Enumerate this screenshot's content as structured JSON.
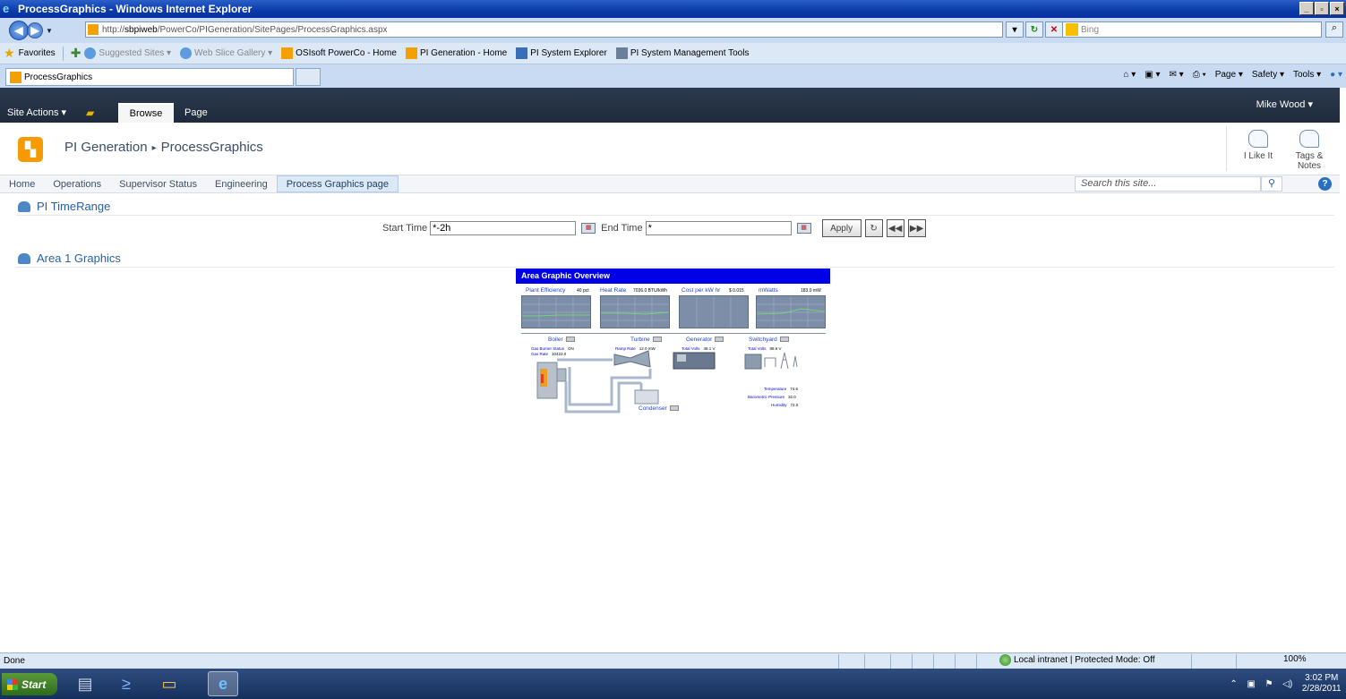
{
  "window": {
    "title": "ProcessGraphics - Windows Internet Explorer"
  },
  "address": {
    "url_prefix": "http://",
    "url_host": "sbpiweb",
    "url_path": "/PowerCo/PIGeneration/SitePages/ProcessGraphics.aspx",
    "search_placeholder": "Bing"
  },
  "favorites": {
    "label": "Favorites",
    "items": [
      {
        "label": "Suggested Sites ▾"
      },
      {
        "label": "Web Slice Gallery ▾"
      },
      {
        "label": "OSIsoft PowerCo - Home"
      },
      {
        "label": "PI Generation - Home"
      },
      {
        "label": "PI System Explorer"
      },
      {
        "label": "PI System Management Tools"
      }
    ]
  },
  "tabs": {
    "active_label": "ProcessGraphics",
    "commands": [
      "Page ▾",
      "Safety ▾",
      "Tools ▾"
    ]
  },
  "ribbon": {
    "site_actions": "Site Actions ▾",
    "browse": "Browse",
    "page": "Page",
    "user": "Mike Wood ▾"
  },
  "site": {
    "title": "PI Generation",
    "page": "ProcessGraphics",
    "like_label": "I Like It",
    "tags_label": "Tags & Notes"
  },
  "topnav": {
    "items": [
      "Home",
      "Operations",
      "Supervisor Status",
      "Engineering",
      "Process Graphics page"
    ],
    "search_placeholder": "Search this site..."
  },
  "timerange": {
    "title": "PI TimeRange",
    "start_label": "Start Time",
    "start_value": "*-2h",
    "end_label": "End Time",
    "end_value": "*",
    "apply": "Apply"
  },
  "graphics": {
    "title": "Area 1 Graphics",
    "header": "Area Graphic Overview",
    "trends": [
      {
        "label": "Plant Efficiency",
        "value": "40 pct"
      },
      {
        "label": "Heat Rate",
        "value": "7036.0 BTU/kWh"
      },
      {
        "label": "Cost per kW hr",
        "value": "$ 0.015"
      },
      {
        "label": "mWatts",
        "value": "183.0 mW"
      }
    ],
    "equipment": [
      "Boiler",
      "Turbine",
      "Generator",
      "Switchyard",
      "Condenser"
    ],
    "boiler_values": [
      {
        "label": "Gas Burner Status",
        "value": "ON"
      },
      {
        "label": "Gas Rate",
        "value": "10423.0"
      }
    ],
    "turbine_value": {
      "label": "Ramp Rate",
      "value": "12.0 mW"
    },
    "generator_value": {
      "label": "Total Volts",
      "value": "48.1 V"
    },
    "switchyard_value": {
      "label": "Total Volts",
      "value": "88.6 V"
    },
    "weather": [
      {
        "label": "Temperature",
        "value": "74.6"
      },
      {
        "label": "Barometric Pressure",
        "value": "32.0"
      },
      {
        "label": "Humidity",
        "value": "72.0"
      }
    ]
  },
  "status": {
    "text": "Done",
    "zone": "Local intranet | Protected Mode: Off",
    "zoom": "100%"
  },
  "taskbar": {
    "start": "Start",
    "time": "3:02 PM",
    "date": "2/28/2011"
  }
}
